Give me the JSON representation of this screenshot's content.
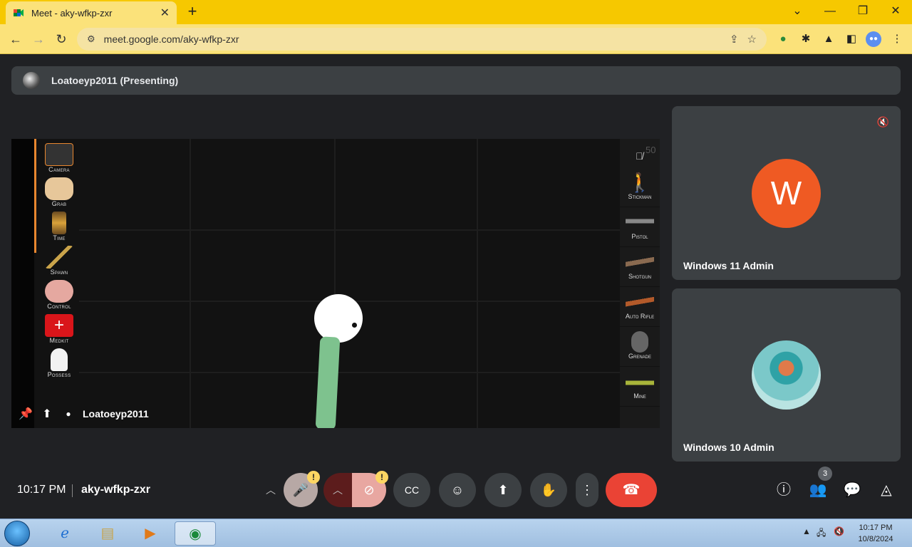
{
  "browser": {
    "tab_title": "Meet - aky-wfkp-zxr",
    "url": "meet.google.com/aky-wfkp-zxr",
    "new_tab_symbol": "+",
    "close_tab_symbol": "✕",
    "window_controls": [
      "⌄",
      "—",
      "❐",
      "✕"
    ]
  },
  "meet": {
    "presenting_label": "Loatoeyp2011 (Presenting)",
    "presenter_name": "Loatoeyp2011",
    "participants": [
      {
        "name": "Windows 11 Admin",
        "avatar_letter": "W",
        "avatar_color": "#ef5a23",
        "muted": true
      },
      {
        "name": "Windows 10 Admin",
        "muted": false
      }
    ],
    "time": "10:17 PM",
    "meeting_code": "aky-wfkp-zxr",
    "people_count": "3",
    "warning_symbol": "!"
  },
  "game": {
    "counter": "50",
    "left_tools": [
      "Camera",
      "Grab",
      "Time",
      "Spawn",
      "Control",
      "Medkit",
      "Possess"
    ],
    "right_tools": [
      "Stickman",
      "Pistol",
      "Shotgun",
      "Auto Rifle",
      "Grenade",
      "Mine"
    ]
  },
  "taskbar": {
    "clock_time": "10:17 PM",
    "clock_date": "10/8/2024"
  },
  "colors": {
    "chrome_yellow": "#f6c800",
    "meet_bg": "#202124",
    "end_call": "#ea4335"
  }
}
